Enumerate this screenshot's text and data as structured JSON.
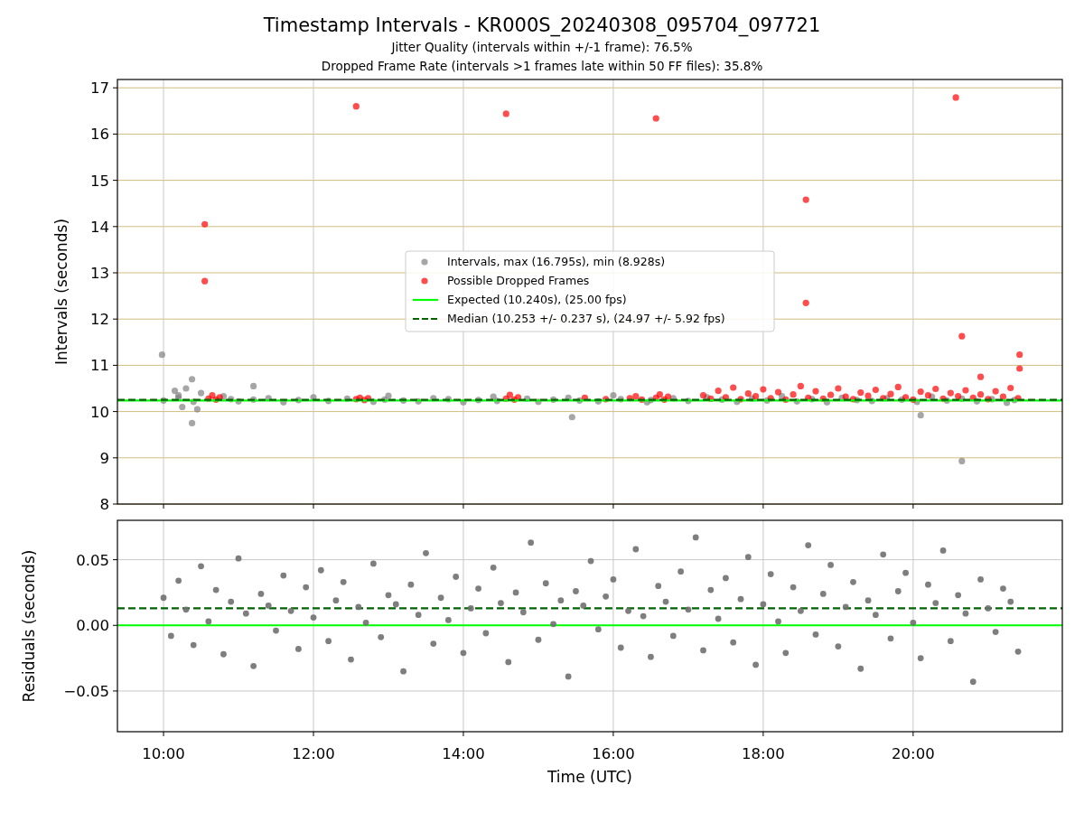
{
  "figure": {
    "title": "Timestamp Intervals - KR000S_20240308_095704_097721",
    "subtitles": [
      "Jitter Quality (intervals within +/-1 frame): 76.5%",
      "Dropped Frame Rate (intervals >1 frames late within 50 FF files): 35.8%"
    ]
  },
  "intervals_plot": {
    "chart_data": {
      "type": "scatter",
      "ylabel": "Intervals (seconds)",
      "xlim": [
        9.385,
        21.99
      ],
      "ylim": [
        8,
        17.18
      ],
      "grid": true,
      "yticks": [
        {
          "value": 8,
          "label": "8"
        },
        {
          "value": 9,
          "label": "9"
        },
        {
          "value": 10,
          "label": "10"
        },
        {
          "value": 11,
          "label": "11"
        },
        {
          "value": 12,
          "label": "12"
        },
        {
          "value": 13,
          "label": "13"
        },
        {
          "value": 14,
          "label": "14"
        },
        {
          "value": 15,
          "label": "15"
        },
        {
          "value": 16,
          "label": "16"
        },
        {
          "value": 17,
          "label": "17"
        }
      ],
      "series": [
        {
          "name": "Intervals, max (16.795s), min (8.928s)",
          "color": "#808080",
          "x": [
            9.98,
            10.38,
            10.38,
            11.2,
            15.45,
            20.1,
            20.65,
            10.15,
            10.25,
            10.3,
            10.45,
            10.5,
            10.2,
            10,
            10.2,
            10.4,
            10.9,
            10.8,
            11,
            11.2,
            11.4,
            11.6,
            11.8,
            12,
            12.2,
            12.45,
            12.8,
            12.95,
            13,
            13.2,
            13.4,
            13.6,
            13.8,
            14,
            14.2,
            14.4,
            14.45,
            14.85,
            15,
            15.2,
            15.4,
            15.55,
            15.8,
            16,
            16.1,
            16.45,
            16.5,
            16.8,
            17,
            17.25,
            17.45,
            17.65,
            17.85,
            18.05,
            18.25,
            18.45,
            18.65,
            18.85,
            19.05,
            19.25,
            19.45,
            19.65,
            19.85,
            20.05,
            20.25,
            20.45,
            20.65,
            20.85,
            21.05,
            21.25,
            21.35
          ],
          "values": [
            11.23,
            10.7,
            9.75,
            10.55,
            9.88,
            9.92,
            8.93,
            10.45,
            10.1,
            10.5,
            10.05,
            10.4,
            10.35,
            10.24,
            10.3,
            10.21,
            10.27,
            10.33,
            10.22,
            10.26,
            10.29,
            10.2,
            10.25,
            10.31,
            10.23,
            10.28,
            10.21,
            10.26,
            10.34,
            10.24,
            10.22,
            10.29,
            10.27,
            10.2,
            10.25,
            10.32,
            10.23,
            10.28,
            10.21,
            10.26,
            10.3,
            10.24,
            10.22,
            10.35,
            10.27,
            10.2,
            10.25,
            10.29,
            10.23,
            10.31,
            10.26,
            10.21,
            10.28,
            10.24,
            10.33,
            10.22,
            10.27,
            10.2,
            10.3,
            10.25,
            10.23,
            10.29,
            10.26,
            10.21,
            10.32,
            10.24,
            10.28,
            10.22,
            10.27,
            10.19,
            10.25
          ]
        },
        {
          "name": "Possible Dropped Frames",
          "color": "#ff0000",
          "x": [
            10.55,
            10.55,
            12.57,
            14.57,
            16.57,
            18.57,
            18.57,
            20.57,
            20.65,
            20.9,
            21.42,
            21.42,
            10.6,
            10.65,
            10.7,
            10.75,
            12.57,
            12.62,
            12.68,
            12.73,
            14.57,
            14.62,
            14.68,
            14.73,
            15.62,
            15.9,
            16.22,
            16.3,
            16.38,
            16.57,
            16.62,
            16.68,
            16.73,
            17.2,
            17.3,
            17.4,
            17.5,
            17.6,
            17.7,
            17.8,
            17.9,
            18,
            18.1,
            18.2,
            18.3,
            18.4,
            18.5,
            18.6,
            18.7,
            18.8,
            18.9,
            19,
            19.1,
            19.2,
            19.3,
            19.4,
            19.5,
            19.6,
            19.7,
            19.8,
            19.9,
            20,
            20.1,
            20.2,
            20.3,
            20.4,
            20.5,
            20.6,
            20.7,
            20.8,
            20.9,
            21,
            21.1,
            21.2,
            21.3,
            21.4
          ],
          "values": [
            14.05,
            12.82,
            16.6,
            16.44,
            16.34,
            14.58,
            12.35,
            16.79,
            11.63,
            10.75,
            11.23,
            10.93,
            10.28,
            10.35,
            10.26,
            10.31,
            10.27,
            10.3,
            10.25,
            10.29,
            10.28,
            10.36,
            10.26,
            10.31,
            10.3,
            10.27,
            10.29,
            10.33,
            10.26,
            10.3,
            10.37,
            10.26,
            10.32,
            10.35,
            10.28,
            10.45,
            10.31,
            10.52,
            10.27,
            10.39,
            10.33,
            10.48,
            10.29,
            10.42,
            10.26,
            10.37,
            10.55,
            10.3,
            10.44,
            10.28,
            10.36,
            10.5,
            10.32,
            10.27,
            10.41,
            10.34,
            10.47,
            10.29,
            10.38,
            10.53,
            10.31,
            10.26,
            10.43,
            10.35,
            10.49,
            10.28,
            10.4,
            10.33,
            10.46,
            10.3,
            10.37,
            10.27,
            10.44,
            10.32,
            10.51,
            10.29
          ]
        }
      ],
      "legend": "center",
      "ref_lines": [
        {
          "axis": "y",
          "value": 10.24,
          "color": "#00ff00",
          "label": "Expected (10.240s), (25.00 fps)"
        },
        {
          "axis": "y",
          "value": 10.253,
          "color": "#006400",
          "label": "Median (10.253 +/- 0.237 s), (24.97 +/- 5.92 fps)"
        }
      ]
    }
  },
  "residuals_plot": {
    "chart_data": {
      "type": "scatter",
      "xlabel": "Time (UTC)",
      "ylabel": "Residuals (seconds)",
      "xlim": [
        9.385,
        21.99
      ],
      "ylim": [
        -0.081,
        0.08
      ],
      "grid": true,
      "xticks": [
        {
          "value": 10,
          "label": "10:00"
        },
        {
          "value": 12,
          "label": "12:00"
        },
        {
          "value": 14,
          "label": "14:00"
        },
        {
          "value": 16,
          "label": "16:00"
        },
        {
          "value": 18,
          "label": "18:00"
        },
        {
          "value": 20,
          "label": "20:00"
        }
      ],
      "yticks": [
        {
          "value": 0.05,
          "label": "0.05"
        },
        {
          "value": 0,
          "label": "0.00"
        },
        {
          "value": -0.05,
          "label": "−0.05"
        }
      ],
      "series": [
        {
          "color": "#707070",
          "x": [
            10,
            10.1,
            10.2,
            10.3,
            10.4,
            10.5,
            10.6,
            10.7,
            10.8,
            10.9,
            11,
            11.1,
            11.2,
            11.3,
            11.4,
            11.5,
            11.6,
            11.7,
            11.8,
            11.9,
            12,
            12.1,
            12.2,
            12.3,
            12.4,
            12.5,
            12.6,
            12.7,
            12.8,
            12.9,
            13,
            13.1,
            13.2,
            13.3,
            13.4,
            13.5,
            13.6,
            13.7,
            13.8,
            13.9,
            14,
            14.1,
            14.2,
            14.3,
            14.4,
            14.5,
            14.6,
            14.7,
            14.8,
            14.9,
            15,
            15.1,
            15.2,
            15.3,
            15.4,
            15.5,
            15.6,
            15.7,
            15.8,
            15.9,
            16,
            16.1,
            16.2,
            16.3,
            16.4,
            16.5,
            16.6,
            16.7,
            16.8,
            16.9,
            17,
            17.1,
            17.2,
            17.3,
            17.4,
            17.5,
            17.6,
            17.7,
            17.8,
            17.9,
            18,
            18.1,
            18.2,
            18.3,
            18.4,
            18.5,
            18.6,
            18.7,
            18.8,
            18.9,
            19,
            19.1,
            19.2,
            19.3,
            19.4,
            19.5,
            19.6,
            19.7,
            19.8,
            19.9,
            20,
            20.1,
            20.2,
            20.3,
            20.4,
            20.5,
            20.6,
            20.7,
            20.8,
            20.9,
            21,
            21.1,
            21.2,
            21.3,
            21.4
          ],
          "values": [
            0.021,
            -0.008,
            0.034,
            0.012,
            -0.015,
            0.045,
            0.003,
            0.027,
            -0.022,
            0.018,
            0.051,
            0.009,
            -0.031,
            0.024,
            0.015,
            -0.004,
            0.038,
            0.011,
            -0.018,
            0.029,
            0.006,
            0.042,
            -0.012,
            0.019,
            0.033,
            -0.026,
            0.014,
            0.002,
            0.047,
            -0.009,
            0.023,
            0.016,
            -0.035,
            0.031,
            0.008,
            0.055,
            -0.014,
            0.021,
            0.004,
            0.037,
            -0.021,
            0.013,
            0.028,
            -0.006,
            0.044,
            0.017,
            -0.028,
            0.025,
            0.01,
            0.063,
            -0.011,
            0.032,
            0.001,
            0.019,
            -0.039,
            0.026,
            0.015,
            0.049,
            -0.003,
            0.022,
            0.035,
            -0.017,
            0.011,
            0.058,
            0.007,
            -0.024,
            0.03,
            0.018,
            -0.008,
            0.041,
            0.012,
            0.067,
            -0.019,
            0.027,
            0.005,
            0.036,
            -0.013,
            0.02,
            0.052,
            -0.03,
            0.016,
            0.039,
            0.003,
            -0.021,
            0.029,
            0.011,
            0.061,
            -0.007,
            0.024,
            0.046,
            -0.016,
            0.014,
            0.033,
            -0.033,
            0.019,
            0.008,
            0.054,
            -0.01,
            0.026,
            0.04,
            0.002,
            -0.025,
            0.031,
            0.017,
            0.057,
            -0.012,
            0.023,
            0.009,
            -0.043,
            0.035,
            0.013,
            -0.005,
            0.028,
            0.018,
            -0.02
          ]
        }
      ],
      "ref_lines": [
        {
          "axis": "y",
          "value": 0,
          "color": "#00ff00"
        },
        {
          "axis": "y",
          "value": 0.013,
          "color": "#006400"
        }
      ]
    }
  }
}
